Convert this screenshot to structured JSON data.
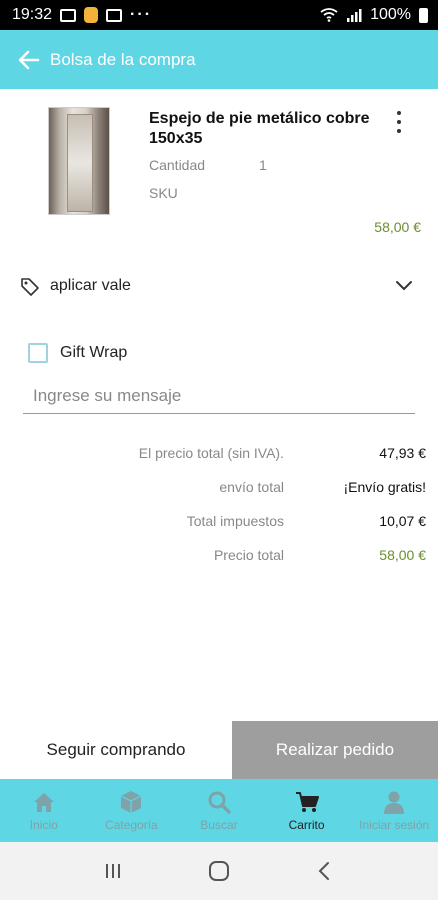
{
  "status_bar": {
    "time": "19:32",
    "dots": "···",
    "battery": "100%",
    "icons": [
      "gallery-icon",
      "notification-app-icon",
      "video-icon",
      "wifi-icon",
      "signal-icon",
      "battery-icon"
    ]
  },
  "app_bar": {
    "title": "Bolsa de la compra",
    "back_icon": "arrow-left-icon"
  },
  "product": {
    "name": "Espejo de pie metálico cobre 150x35",
    "quantity_label": "Cantidad",
    "quantity_value": "1",
    "sku_label": "SKU",
    "price": "58,00 €",
    "menu_icon": "more-vertical-icon"
  },
  "voucher": {
    "label": "aplicar vale",
    "icon": "tag-icon",
    "expand_icon": "chevron-down-icon"
  },
  "gift_wrap": {
    "label": "Gift Wrap",
    "checked": false
  },
  "message": {
    "placeholder": "Ingrese su mensaje",
    "value": ""
  },
  "totals": [
    {
      "label": "El precio total (sin IVA).",
      "value": "47,93 €",
      "highlight": false
    },
    {
      "label": "envío total",
      "value": "¡Envío gratis!",
      "highlight": false
    },
    {
      "label": "Total impuestos",
      "value": "10,07 €",
      "highlight": false
    },
    {
      "label": "Precio total",
      "value": "58,00 €",
      "highlight": true
    }
  ],
  "actions": {
    "continue_label": "Seguir comprando",
    "order_label": "Realizar pedido"
  },
  "bottom_nav": [
    {
      "label": "Inicio",
      "icon": "home-icon",
      "active": false
    },
    {
      "label": "Categoría",
      "icon": "box-icon",
      "active": false
    },
    {
      "label": "Buscar",
      "icon": "search-icon",
      "active": false
    },
    {
      "label": "Carrito",
      "icon": "cart-icon",
      "active": true
    },
    {
      "label": "Iniciar sesión",
      "icon": "user-icon",
      "active": false
    }
  ],
  "colors": {
    "accent": "#5ed6e4",
    "price_green": "#6b8e2e",
    "order_button": "#9e9e9e"
  }
}
